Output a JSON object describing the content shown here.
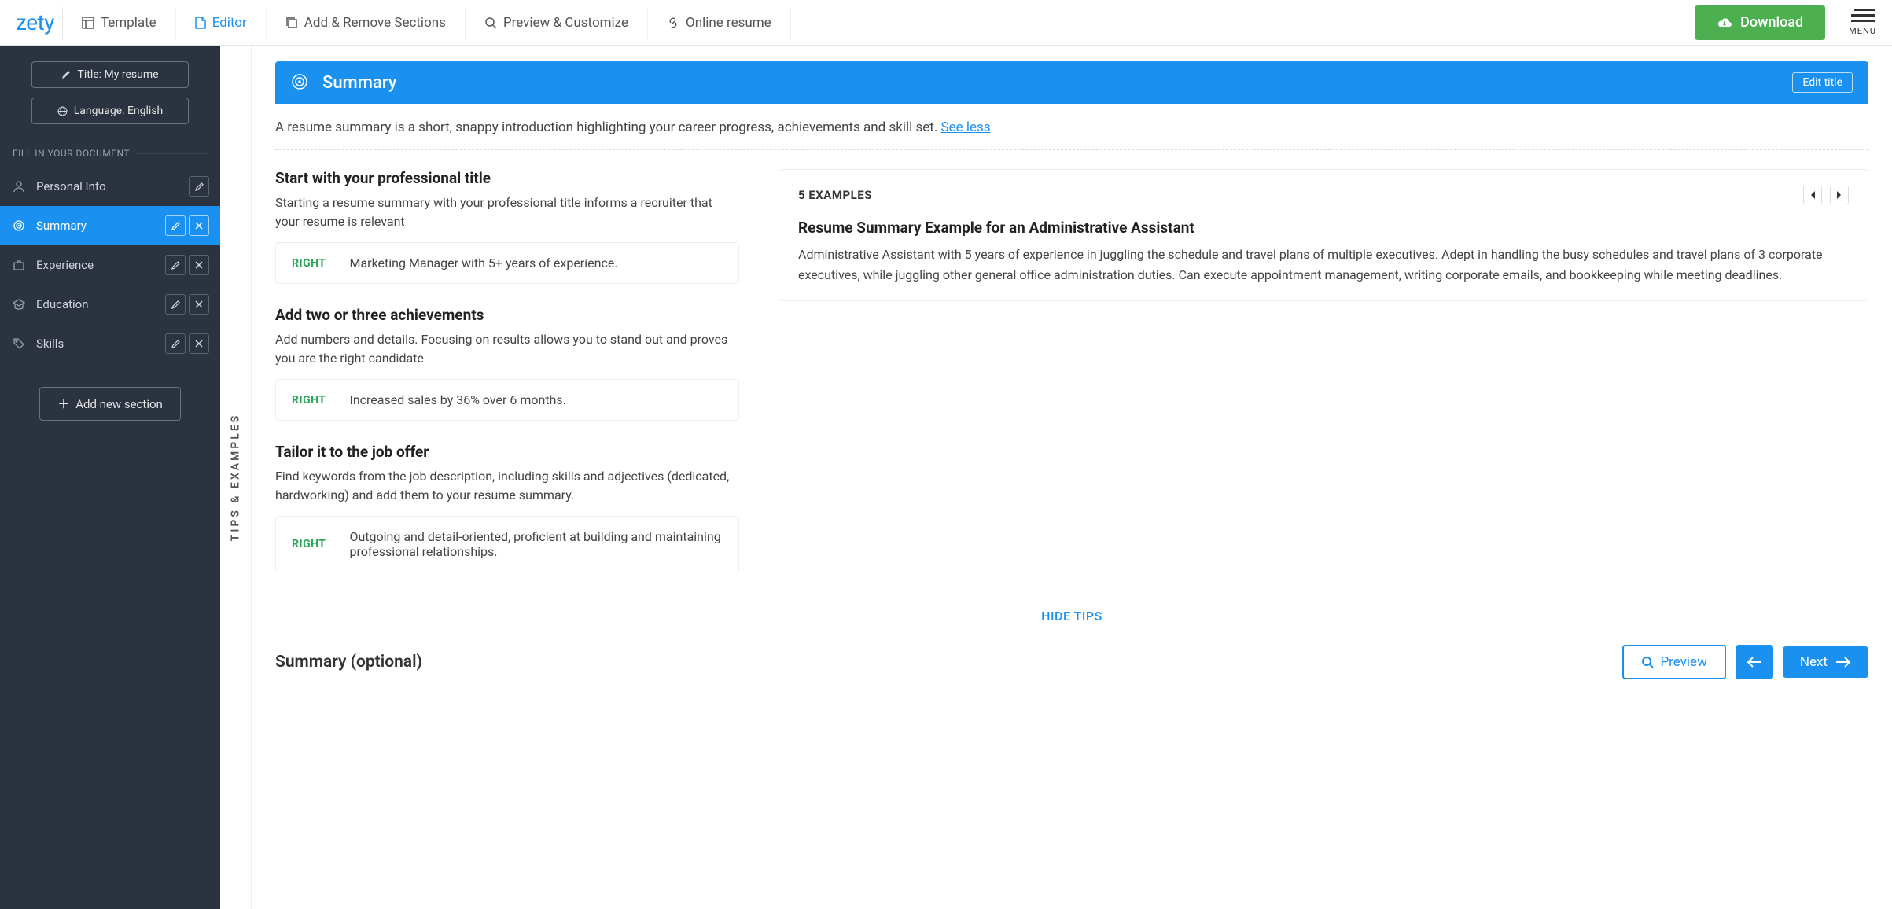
{
  "brand": "zety",
  "topnav": {
    "template": "Template",
    "editor": "Editor",
    "add_remove": "Add & Remove Sections",
    "preview": "Preview & Customize",
    "online": "Online resume",
    "download": "Download",
    "menu": "MENU"
  },
  "sidebar": {
    "title_btn": "Title: My resume",
    "lang_btn": "Language: English",
    "fill_label": "FILL IN YOUR DOCUMENT",
    "sections": [
      {
        "label": "Personal Info"
      },
      {
        "label": "Summary"
      },
      {
        "label": "Experience"
      },
      {
        "label": "Education"
      },
      {
        "label": "Skills"
      }
    ],
    "add_new": "Add new section"
  },
  "header": {
    "title": "Summary",
    "edit": "Edit title"
  },
  "intro": {
    "text": "A resume summary is a short, snappy introduction highlighting your career progress, achievements and skill set.",
    "see_less": "See less"
  },
  "tips_rail": "TIPS & EXAMPLES",
  "tips": [
    {
      "heading": "Start with your professional title",
      "body": "Starting a resume summary with your professional title informs a recruiter that your resume is relevant",
      "right_label": "RIGHT",
      "example": "Marketing Manager with 5+ years of experience."
    },
    {
      "heading": "Add two or three achievements",
      "body": "Add numbers and details. Focusing on results allows you to stand out and proves you are the right candidate",
      "right_label": "RIGHT",
      "example": "Increased sales by 36% over 6 months."
    },
    {
      "heading": "Tailor it to the job offer",
      "body": "Find keywords from the job description, including skills and adjectives (dedicated, hardworking) and add them to your resume summary.",
      "right_label": "RIGHT",
      "example": "Outgoing and detail-oriented, proficient at building and maintaining professional relationships."
    }
  ],
  "examples": {
    "count_label": "5 EXAMPLES",
    "title": "Resume Summary Example for an Administrative Assistant",
    "body": "Administrative Assistant with 5 years of experience in juggling the schedule and travel plans of multiple executives. Adept in handling the busy schedules and travel plans of 3 corporate executives, while juggling other general office administration duties. Can execute appointment management, writing corporate emails, and bookkeeping while meeting deadlines."
  },
  "hide_tips": "HIDE TIPS",
  "footer": {
    "optional": "Summary (optional)",
    "preview": "Preview",
    "next": "Next"
  }
}
